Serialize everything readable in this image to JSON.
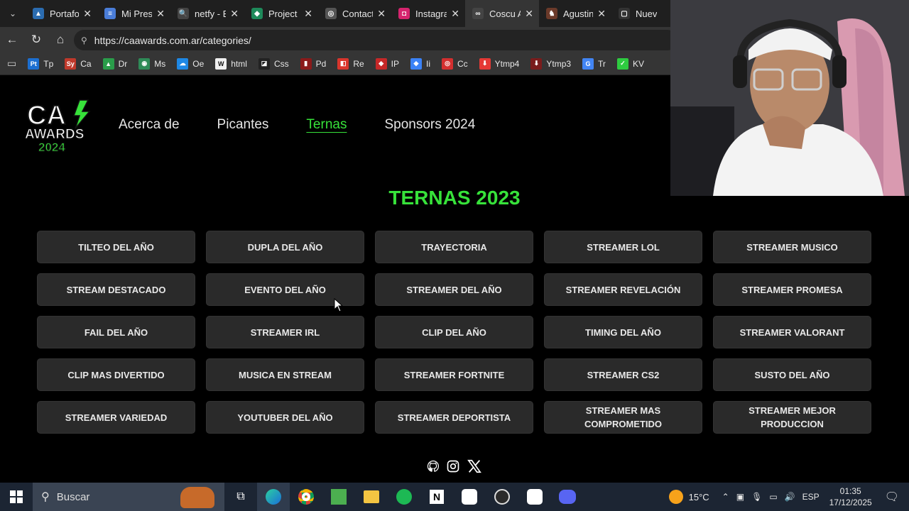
{
  "browser": {
    "tabs": [
      {
        "label": "Portafolio",
        "fav_color": "#2b6cb0",
        "fav": "▲"
      },
      {
        "label": "Mi Presen",
        "fav_color": "#4a7dd8",
        "fav": "≡"
      },
      {
        "label": "netfy - Bú",
        "fav_color": "#444",
        "fav": "🔍"
      },
      {
        "label": "Project ov",
        "fav_color": "#1e8a5a",
        "fav": "◆"
      },
      {
        "label": "Contacto",
        "fav_color": "#555",
        "fav": "◎"
      },
      {
        "label": "Instagram",
        "fav_color": "#d6246e",
        "fav": "◘"
      },
      {
        "label": "Coscu Arr",
        "fav_color": "#444",
        "fav": "∞"
      },
      {
        "label": "Agustin B",
        "fav_color": "#6b3a2a",
        "fav": "♞"
      },
      {
        "label": "Nueva pe",
        "fav_color": "#333",
        "fav": "▢"
      }
    ],
    "url": "https://caawards.com.ar/categories/",
    "bookmarks": [
      {
        "label": "Tp",
        "color": "#1c6fd1",
        "icon": "Pt"
      },
      {
        "label": "Ca",
        "color": "#c0392b",
        "icon": "Sy"
      },
      {
        "label": "Dr",
        "color": "#2a9d4a",
        "icon": "▲"
      },
      {
        "label": "Ms",
        "color": "#2e8b57",
        "icon": "◉"
      },
      {
        "label": "Oe",
        "color": "#1e88e5",
        "icon": "☁"
      },
      {
        "label": "html",
        "color": "#f0f0f0",
        "icon": "W"
      },
      {
        "label": "Css",
        "color": "#222",
        "icon": "◪"
      },
      {
        "label": "Pd",
        "color": "#8b1a1a",
        "icon": "▮"
      },
      {
        "label": "Re",
        "color": "#d9352c",
        "icon": "◧"
      },
      {
        "label": "IP",
        "color": "#c62828",
        "icon": "◆"
      },
      {
        "label": "Ii",
        "color": "#3b82f6",
        "icon": "◆"
      },
      {
        "label": "Cc",
        "color": "#d32f2f",
        "icon": "◎"
      },
      {
        "label": "Ytmp4",
        "color": "#e53935",
        "icon": "⬇"
      },
      {
        "label": "Ytmp3",
        "color": "#7a1c1c",
        "icon": "⬇"
      },
      {
        "label": "Tr",
        "color": "#4285f4",
        "icon": "G"
      },
      {
        "label": "KV",
        "color": "#2ecc40",
        "icon": "✓"
      }
    ]
  },
  "site": {
    "logo_line1": "CA",
    "logo_line2": "AWARDS",
    "logo_line3": "2024",
    "nav": [
      "Acerca de",
      "Picantes",
      "Ternas",
      "Sponsors 2024"
    ],
    "heading": "TERNAS 2023",
    "categories": [
      "TILTEO DEL AÑO",
      "DUPLA DEL AÑO",
      "TRAYECTORIA",
      "STREAMER LOL",
      "STREAMER MUSICO",
      "STREAM DESTACADO",
      "EVENTO DEL AÑO",
      "STREAMER DEL AÑO",
      "STREAMER REVELACIÓN",
      "STREAMER PROMESA",
      "FAIL DEL AÑO",
      "STREAMER IRL",
      "CLIP DEL AÑO",
      "TIMING DEL AÑO",
      "STREAMER VALORANT",
      "CLIP MAS DIVERTIDO",
      "MUSICA EN STREAM",
      "STREAMER FORTNITE",
      "STREAMER CS2",
      "SUSTO DEL AÑO",
      "STREAMER VARIEDAD",
      "YOUTUBER DEL AÑO",
      "STREAMER DEPORTISTA",
      "STREAMER MAS COMPROMETIDO",
      "STREAMER MEJOR PRODUCCION"
    ],
    "socials": [
      "github-icon",
      "instagram-icon",
      "x-icon"
    ]
  },
  "taskbar": {
    "search_placeholder": "Buscar",
    "weather": "15°C",
    "language": "ESP",
    "time": "01:35",
    "date": "17/12/2025"
  },
  "colors": {
    "accent": "#37e23a",
    "card": "#2a2a2a"
  }
}
